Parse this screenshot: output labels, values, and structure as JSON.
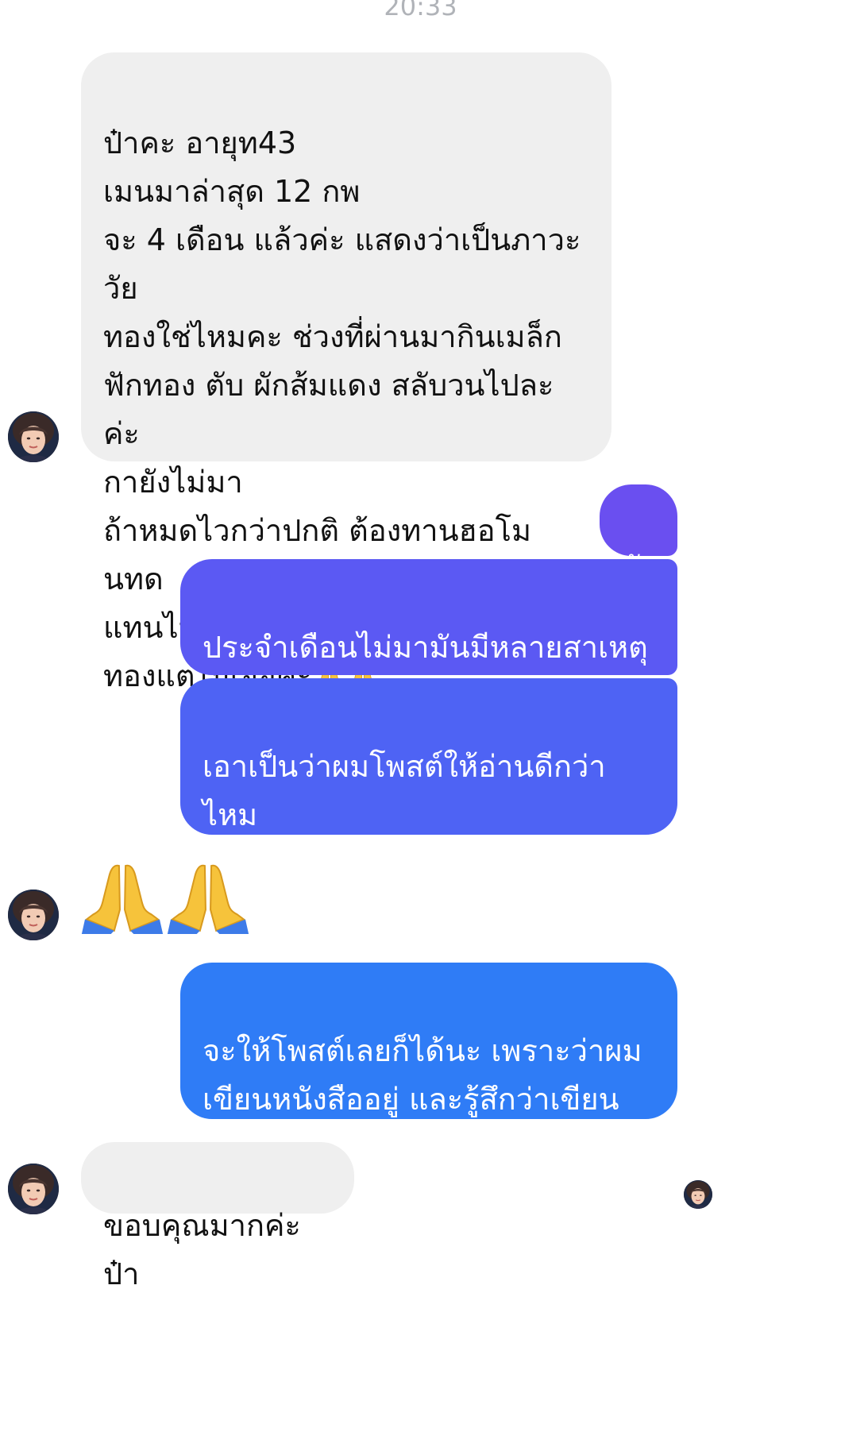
{
  "timestamp": "20:33",
  "colors": {
    "incoming_bg": "#efefef",
    "outgoing_top": "#6a4ff0",
    "outgoing_mid": "#5a5ef5",
    "outgoing_bottom": "#2f7cf6",
    "timestamp": "#b0b3b8"
  },
  "messages": [
    {
      "sender": "them",
      "text": "ป๋าคะ อายุท43\nเมนมาล่าสุด 12 กพ\nจะ 4 เดือน แล้วค่ะ แสดงว่าเป็นภาวะวัย\nทองใช่ไหมคะ ช่วงที่ผ่านมากินเมล็ก\nฟักทอง ตับ ผักส้มแดง สลับวนไปละค่ะ\nกายังไม่มา\nถ้าหมดไวกว่าปกติ ต้องทานฮอโมนทด\nแทนไหมคะป๋า พยายามค้นหาตอนวัย\nทองแต่ไม่เจอค่ะ",
      "trailing_emoji": "folded-hands x2"
    },
    {
      "sender": "me",
      "text": "ยัง"
    },
    {
      "sender": "me",
      "text": "ประจำเดือนไม่มามันมีหลายสาเหตุ\nมากครับ"
    },
    {
      "sender": "me",
      "text": "เอาเป็นว่าผมโพสต์ให้อ่านดีกว่าไหม\nถ้าซักประวัติรายบุคคลแบบนี้ผมไม่\nไหว"
    },
    {
      "sender": "them",
      "emoji": "folded-hands x2"
    },
    {
      "sender": "me",
      "text": "จะให้โพสต์เลยก็ได้นะ เพราะว่าผม\nเขียนหนังสืออยู่ และรู้สึกว่าเขียน\nเรื่องนี้แล้วด้วย"
    },
    {
      "sender": "them",
      "text": "ขอบคุณมากค่ะป๋า"
    }
  ]
}
